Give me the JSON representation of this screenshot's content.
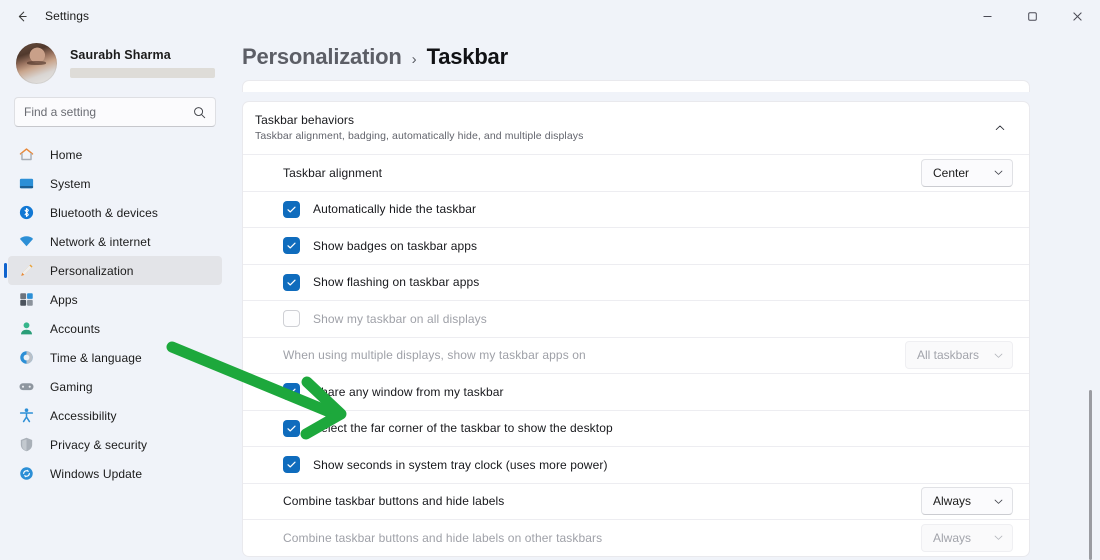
{
  "window": {
    "title": "Settings",
    "back_icon": "back-arrow-icon",
    "minimize_label": "—",
    "maximize_label": "❐",
    "close_label": "✕"
  },
  "sidebar": {
    "profile": {
      "name": "Saurabh Sharma",
      "email_redacted": true
    },
    "search": {
      "placeholder": "Find a setting",
      "value": "",
      "icon": "search-icon"
    },
    "items": [
      {
        "label": "Home",
        "icon": "home-icon",
        "selected": false
      },
      {
        "label": "System",
        "icon": "system-icon",
        "selected": false
      },
      {
        "label": "Bluetooth & devices",
        "icon": "bluetooth-icon",
        "selected": false
      },
      {
        "label": "Network & internet",
        "icon": "network-icon",
        "selected": false
      },
      {
        "label": "Personalization",
        "icon": "personalization-icon",
        "selected": true
      },
      {
        "label": "Apps",
        "icon": "apps-icon",
        "selected": false
      },
      {
        "label": "Accounts",
        "icon": "accounts-icon",
        "selected": false
      },
      {
        "label": "Time & language",
        "icon": "time-language-icon",
        "selected": false
      },
      {
        "label": "Gaming",
        "icon": "gaming-icon",
        "selected": false
      },
      {
        "label": "Accessibility",
        "icon": "accessibility-icon",
        "selected": false
      },
      {
        "label": "Privacy & security",
        "icon": "privacy-security-icon",
        "selected": false
      },
      {
        "label": "Windows Update",
        "icon": "windows-update-icon",
        "selected": false
      }
    ]
  },
  "breadcrumb": {
    "parent": "Personalization",
    "separator": "›",
    "current": "Taskbar"
  },
  "main": {
    "group": {
      "title": "Taskbar behaviors",
      "subtitle": "Taskbar alignment, badging, automatically hide, and multiple displays",
      "expanded": true,
      "chevron_icon": "chevron-up-icon"
    },
    "rows": [
      {
        "type": "dropdown",
        "label": "Taskbar alignment",
        "value": "Center",
        "disabled": false
      },
      {
        "type": "checkbox",
        "label": "Automatically hide the taskbar",
        "checked": true,
        "disabled": false
      },
      {
        "type": "checkbox",
        "label": "Show badges on taskbar apps",
        "checked": true,
        "disabled": false
      },
      {
        "type": "checkbox",
        "label": "Show flashing on taskbar apps",
        "checked": true,
        "disabled": false
      },
      {
        "type": "checkbox",
        "label": "Show my taskbar on all displays",
        "checked": false,
        "disabled": true
      },
      {
        "type": "dropdown",
        "label": "When using multiple displays, show my taskbar apps on",
        "value": "All taskbars",
        "disabled": true
      },
      {
        "type": "checkbox",
        "label": "Share any window from my taskbar",
        "checked": true,
        "disabled": false
      },
      {
        "type": "checkbox",
        "label": "Select the far corner of the taskbar to show the desktop",
        "checked": true,
        "disabled": false
      },
      {
        "type": "checkbox",
        "label": "Show seconds in system tray clock (uses more power)",
        "checked": true,
        "disabled": false
      },
      {
        "type": "dropdown",
        "label": "Combine taskbar buttons and hide labels",
        "value": "Always",
        "disabled": false
      },
      {
        "type": "dropdown",
        "label": "Combine taskbar buttons and hide labels on other taskbars",
        "value": "Always",
        "disabled": true
      }
    ]
  },
  "annotation": {
    "type": "arrow",
    "color": "#1DA83C",
    "points_to": "Select the far corner of the taskbar to show the desktop"
  },
  "colors": {
    "accent": "#0F6CBD",
    "selection_indicator": "#0F63CE",
    "window_background": "#F0F3F9",
    "card_background": "#FFFFFF",
    "annotation_green": "#1DA83C"
  }
}
